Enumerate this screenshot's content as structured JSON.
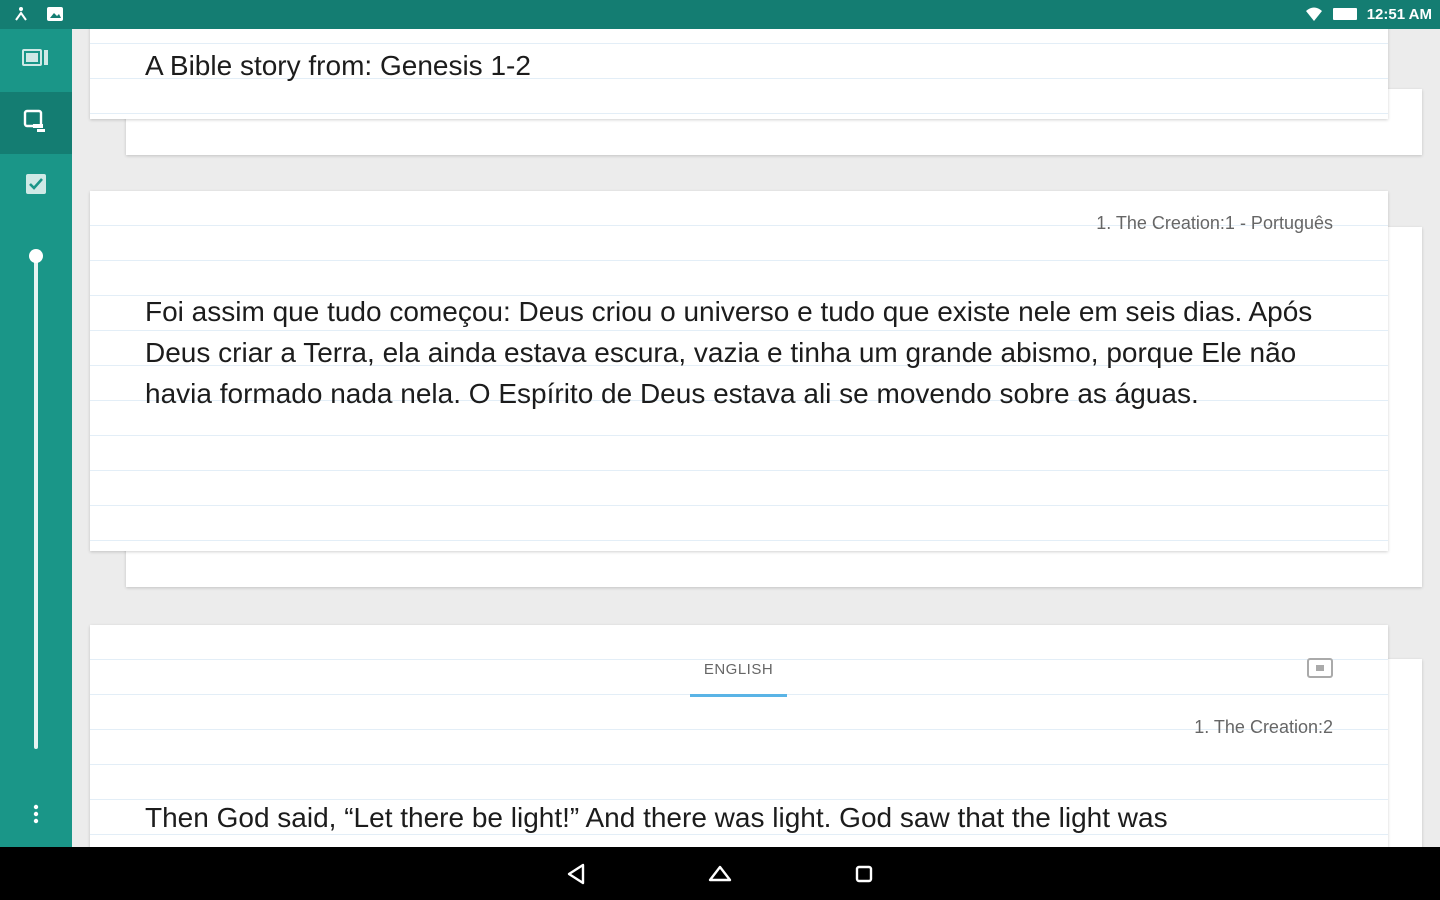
{
  "status_bar": {
    "time": "12:51 AM",
    "left_icons": [
      "person-icon",
      "image-icon"
    ],
    "right_icons": [
      "wifi-icon",
      "battery-icon"
    ]
  },
  "rail": {
    "items": [
      {
        "name": "rail-item-library",
        "icon": "book-icon",
        "active": false
      },
      {
        "name": "rail-item-slides",
        "icon": "slides-icon",
        "active": true
      },
      {
        "name": "rail-item-checklist",
        "icon": "checkbox-icon",
        "active": false
      }
    ],
    "more_icon": "more-vert-icon"
  },
  "cards": {
    "card1": {
      "text": "A Bible story from: Genesis 1-2"
    },
    "card2": {
      "reference": "1. The Creation:1 - Português",
      "text": "Foi assim que tudo começou: Deus criou o universo e tudo que existe nele em seis dias. Após Deus criar a Terra, ela ainda estava escura, vazia e tinha um grande abismo, porque Ele não havia formado nada nela. O Espírito de Deus estava ali se movendo sobre as águas."
    },
    "card3": {
      "tab_label": "ENGLISH",
      "reference": "1. The Creation:2",
      "text": "Then God said, “Let there be light!” And there was light. God saw that the light was"
    }
  },
  "navbar": {
    "buttons": [
      "back-icon",
      "home-icon",
      "recents-icon"
    ]
  },
  "colors": {
    "primary": "#1a9688",
    "primary_dark": "#147d72",
    "accent_underline": "#5ab4e6"
  }
}
